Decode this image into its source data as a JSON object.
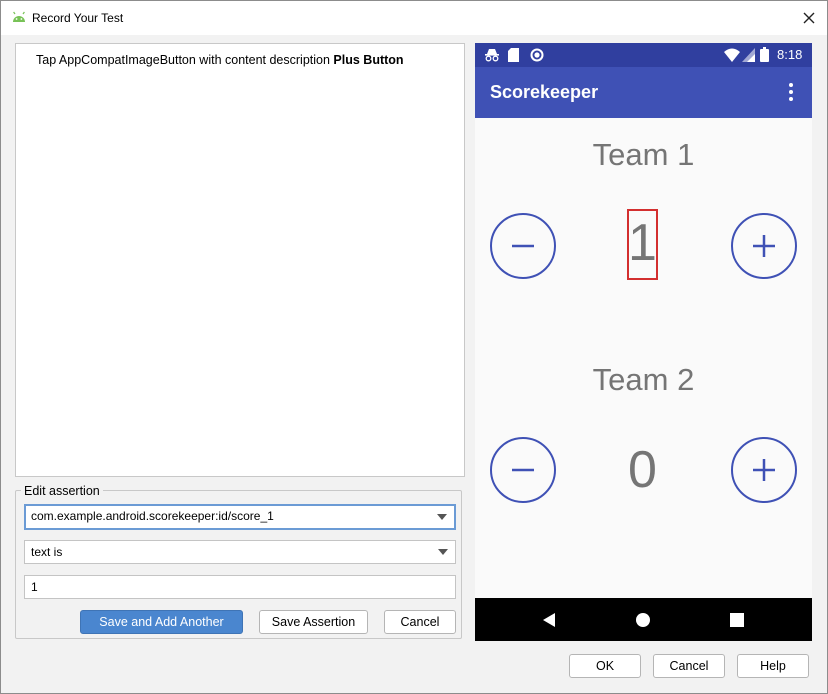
{
  "window": {
    "title": "Record Your Test"
  },
  "steps": [
    {
      "prefix": "Tap AppCompatImageButton with content description",
      "bold": "Plus Button"
    }
  ],
  "assertion": {
    "legend": "Edit assertion",
    "element_id": "com.example.android.scorekeeper:id/score_1",
    "condition": "text is",
    "value": "1",
    "save_and_add_label": "Save and Add Another",
    "save_label": "Save Assertion",
    "cancel_label": "Cancel"
  },
  "phone": {
    "status_time": "8:18",
    "app_title": "Scorekeeper",
    "team1": {
      "label": "Team 1",
      "score": "1"
    },
    "team2": {
      "label": "Team 2",
      "score": "0"
    },
    "accent_color": "#3f51b5",
    "highlight_color": "#d32f2f"
  },
  "footer": {
    "ok_label": "OK",
    "cancel_label": "Cancel",
    "help_label": "Help"
  }
}
